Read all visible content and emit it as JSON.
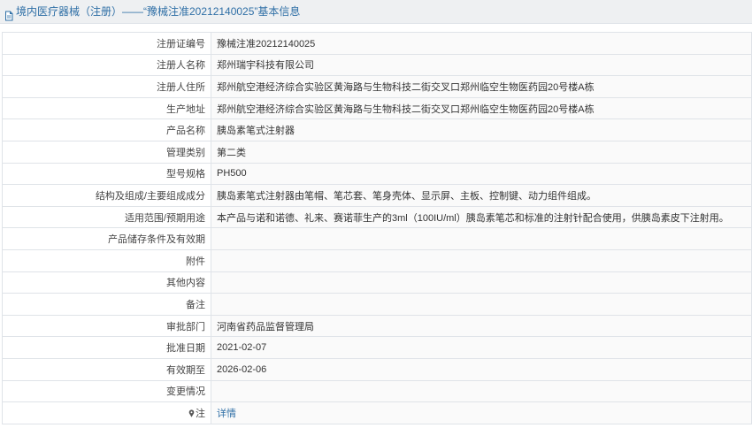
{
  "header": {
    "title": "境内医疗器械（注册）——“豫械注准20212140025”基本信息"
  },
  "rows": [
    {
      "label": "注册证编号",
      "value": "豫械注准20212140025"
    },
    {
      "label": "注册人名称",
      "value": "郑州瑞宇科技有限公司"
    },
    {
      "label": "注册人住所",
      "value": "郑州航空港经济综合实验区黄海路与生物科技二街交叉口郑州临空生物医药园20号楼A栋"
    },
    {
      "label": "生产地址",
      "value": "郑州航空港经济综合实验区黄海路与生物科技二街交叉口郑州临空生物医药园20号楼A栋"
    },
    {
      "label": "产品名称",
      "value": "胰岛素笔式注射器"
    },
    {
      "label": "管理类别",
      "value": "第二类"
    },
    {
      "label": "型号规格",
      "value": "PH500"
    },
    {
      "label": "结构及组成/主要组成成分",
      "value": "胰岛素笔式注射器由笔帽、笔芯套、笔身壳体、显示屏、主板、控制键、动力组件组成。"
    },
    {
      "label": "适用范围/预期用途",
      "value": "本产品与诺和诺德、礼来、赛诺菲生产的3ml（100IU/ml）胰岛素笔芯和标准的注射针配合使用，供胰岛素皮下注射用。"
    },
    {
      "label": "产品储存条件及有效期",
      "value": ""
    },
    {
      "label": "附件",
      "value": ""
    },
    {
      "label": "其他内容",
      "value": ""
    },
    {
      "label": "备注",
      "value": ""
    },
    {
      "label": "审批部门",
      "value": "河南省药品监督管理局"
    },
    {
      "label": "批准日期",
      "value": "2021-02-07"
    },
    {
      "label": "有效期至",
      "value": "2026-02-06"
    },
    {
      "label": "变更情况",
      "value": ""
    }
  ],
  "note_row": {
    "label": "注",
    "link": "详情",
    "icon": "pin-icon"
  },
  "colors": {
    "header_bg": "#eef0f2",
    "header_text": "#2f6fa6",
    "border": "#dfe3e8",
    "link": "#2f6fa6"
  }
}
